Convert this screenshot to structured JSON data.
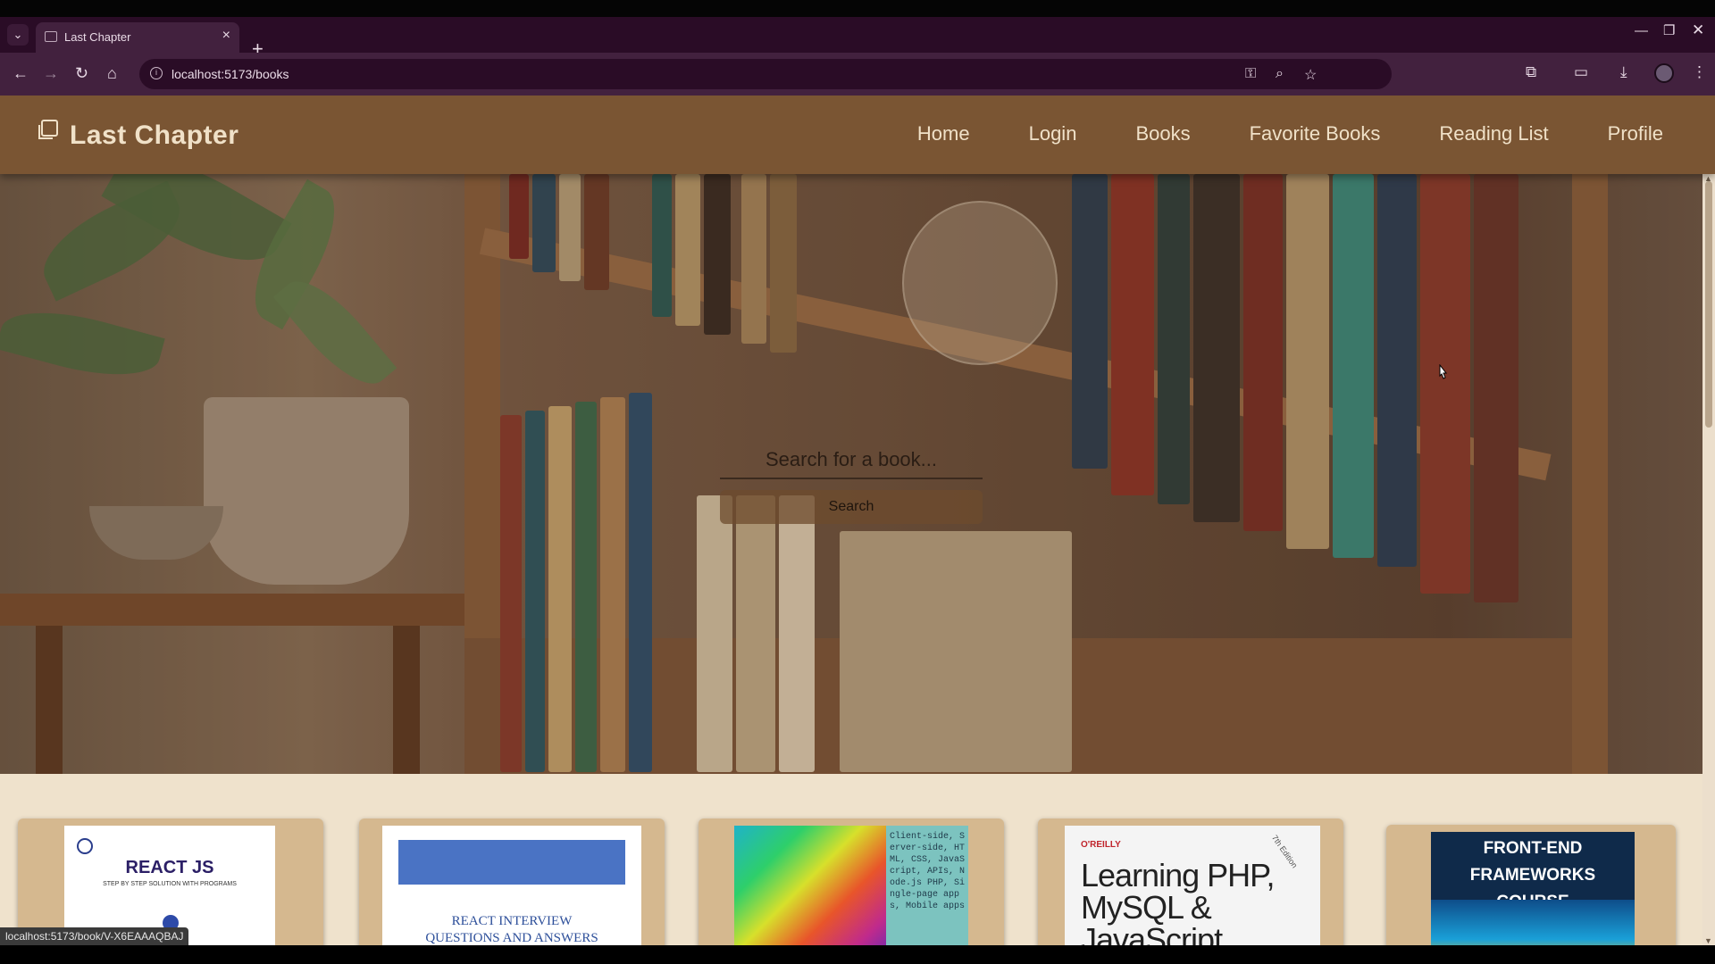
{
  "browser": {
    "tab_title": "Last Chapter",
    "url": "localhost:5173/books",
    "status_url": "localhost:5173/book/V-X6EAAAQBAJ"
  },
  "site": {
    "brand": "Last Chapter",
    "nav": [
      "Home",
      "Login",
      "Books",
      "Favorite Books",
      "Reading List",
      "Profile"
    ]
  },
  "hero": {
    "search_placeholder": "Search for a book...",
    "search_button": "Search"
  },
  "books": [
    {
      "title": "REACT JS",
      "subtitle": "STEP BY STEP SOLUTION WITH PROGRAMS"
    },
    {
      "title": "REACT INTERVIEW QUESTIONS AND ANSWERS"
    },
    {
      "side_text": "Client-side, Server-side, HTML, CSS, JavaScript, APIs, Node.js PHP, Single-page apps, Mobile apps"
    },
    {
      "publisher": "O'REILLY",
      "edition": "7th Edition",
      "title": "Learning PHP, MySQL & JavaScript"
    },
    {
      "title": "FRONT-END FRAMEWORKS COURSE"
    }
  ],
  "colors": {
    "navbar": "#7a5533",
    "nav_text": "#f0e1c8",
    "page_bg": "#efe2cc",
    "card_bg": "#d5b88f",
    "browser_frame": "#42213e"
  }
}
